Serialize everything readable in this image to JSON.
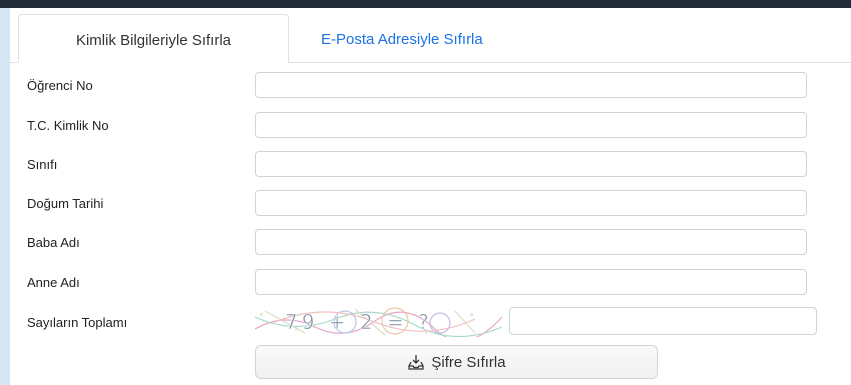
{
  "tabs": [
    {
      "label": "Kimlik Bilgileriyle Sıfırla"
    },
    {
      "label": "E-Posta Adresiyle Sıfırla"
    }
  ],
  "fields": [
    {
      "label": "Öğrenci No",
      "value": ""
    },
    {
      "label": "T.C. Kimlik No",
      "value": ""
    },
    {
      "label": "Sınıfı",
      "value": ""
    },
    {
      "label": "Doğum Tarihi",
      "value": ""
    },
    {
      "label": "Baba Adı",
      "value": ""
    },
    {
      "label": "Anne Adı",
      "value": ""
    }
  ],
  "captcha": {
    "label": "Sayıların Toplamı",
    "challenge": "79 + 2 = ?",
    "value": ""
  },
  "submit": {
    "label": "Şifre Sıfırla",
    "icon": "inbox-download-icon"
  },
  "colors": {
    "tab_link": "#1a73e8",
    "top_bar": "#222c39",
    "side_bg": "#d6e6f2"
  }
}
